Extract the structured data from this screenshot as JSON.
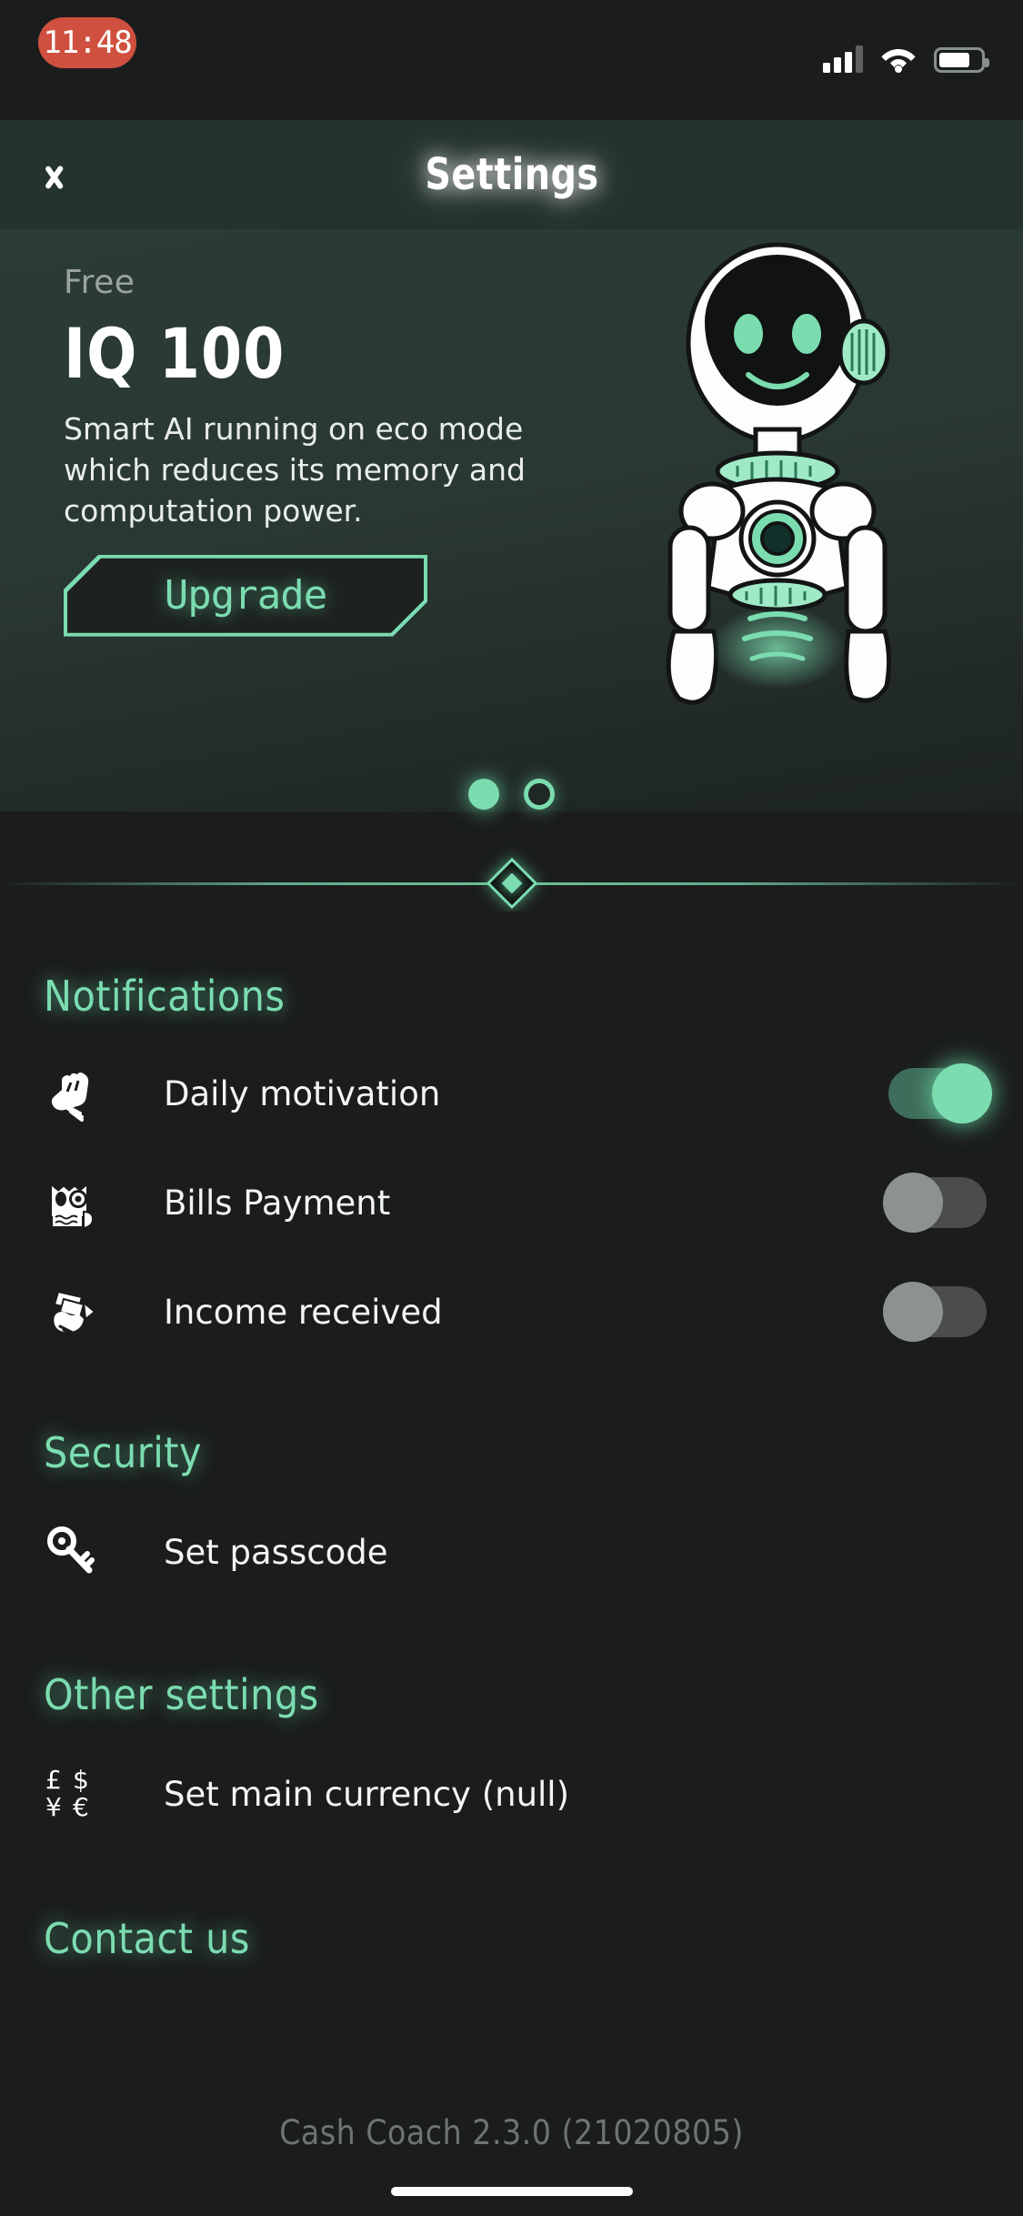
{
  "status_bar": {
    "time": "11:48",
    "recording_indicator": true,
    "signal_icon": "cellular-signal-icon",
    "wifi_icon": "wifi-icon",
    "battery_icon": "battery-icon"
  },
  "header": {
    "title": "Settings",
    "back_icon": "chevron-left-icon"
  },
  "hero": {
    "tier_label": "Free",
    "iq_label": "IQ 100",
    "description": "Smart AI running on eco mode which reduces its memory and computation power.",
    "upgrade_label": "Upgrade",
    "robot_icon": "robot-avatar-illustration",
    "pager": {
      "total": 2,
      "active_index": 0
    }
  },
  "sections": [
    {
      "title": "Notifications",
      "rows": [
        {
          "icon": "fist-icon",
          "label": "Daily motivation",
          "toggle": "on"
        },
        {
          "icon": "bill-icon",
          "label": "Bills Payment",
          "toggle": "off"
        },
        {
          "icon": "cash-hand-icon",
          "label": "Income received",
          "toggle": "off"
        }
      ]
    },
    {
      "title": "Security",
      "rows": [
        {
          "icon": "key-icon",
          "label": "Set passcode",
          "toggle": null
        }
      ]
    },
    {
      "title": "Other settings",
      "rows": [
        {
          "icon": "currency-icon",
          "label": "Set main currency (null)",
          "toggle": null
        }
      ]
    },
    {
      "title": "Contact us",
      "rows": []
    }
  ],
  "footer": {
    "version_text": "Cash Coach 2.3.0 (21020805)"
  },
  "colors": {
    "accent_mint": "#7bdcb0",
    "background": "#1b1d1d",
    "hero_background": "#2b3b35",
    "recording_red": "#d0503f",
    "muted_text": "#9aa3a0"
  }
}
